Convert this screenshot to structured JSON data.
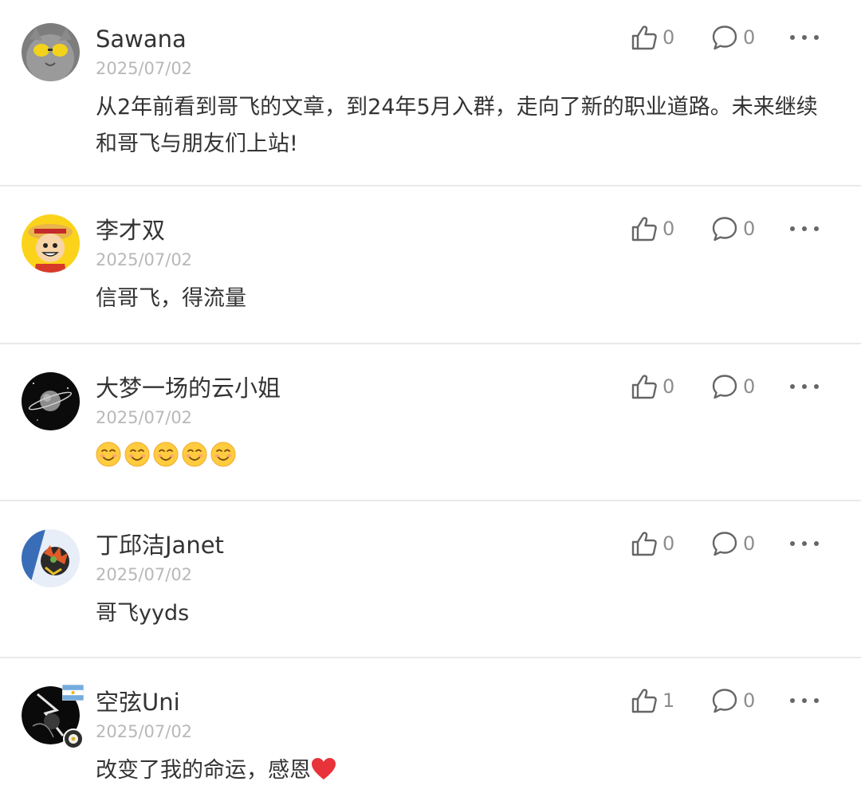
{
  "comments": [
    {
      "name": "Sawana",
      "date": "2025/07/02",
      "text": "从2年前看到哥飞的文章，到24年5月入群，走向了新的职业道路。未来继续和哥飞与朋友们上站!",
      "likes": "0",
      "replies": "0"
    },
    {
      "name": "李才双",
      "date": "2025/07/02",
      "text": "信哥飞，得流量",
      "likes": "0",
      "replies": "0"
    },
    {
      "name": "大梦一场的云小姐",
      "date": "2025/07/02",
      "text": "☺☺☺☺☺",
      "likes": "0",
      "replies": "0"
    },
    {
      "name": "丁邱洁Janet",
      "date": "2025/07/02",
      "text": "哥飞yyds",
      "likes": "0",
      "replies": "0"
    },
    {
      "name": "空弦Uni",
      "date": "2025/07/02",
      "text": "改变了我的命运，感恩",
      "likes": "1",
      "replies": "0"
    }
  ],
  "icons": {
    "like": "thumbs-up-icon",
    "reply": "comment-bubble-icon",
    "more": "more-dots-icon"
  },
  "colors": {
    "text": "#333333",
    "meta": "#b8b8b8",
    "icon": "#666666",
    "count": "#8d8d8d",
    "divider": "#e9e9e9"
  }
}
